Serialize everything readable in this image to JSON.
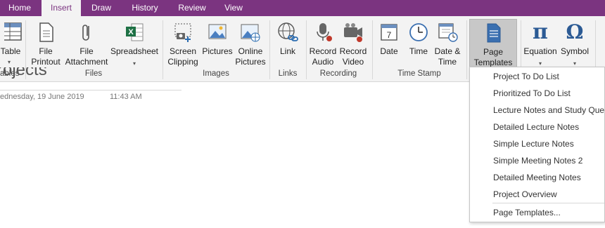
{
  "tabs": [
    "Home",
    "Insert",
    "Draw",
    "History",
    "Review",
    "View"
  ],
  "ribbon": {
    "table": {
      "label": "Table",
      "group": "ables"
    },
    "files": {
      "group": "Files",
      "printout": "File\nPrintout",
      "attachment": "File\nAttachment",
      "spreadsheet": "Spreadsheet"
    },
    "images": {
      "group": "Images",
      "screen_clipping": "Screen\nClipping",
      "pictures": "Pictures",
      "online_pictures": "Online\nPictures"
    },
    "links": {
      "group": "Links",
      "link": "Link"
    },
    "recording": {
      "group": "Recording",
      "audio": "Record\nAudio",
      "video": "Record\nVideo"
    },
    "timestamp": {
      "group": "Time Stamp",
      "date": "Date",
      "time": "Time",
      "date_time": "Date &\nTime",
      "calendar_day": "7"
    },
    "page_templates": "Page\nTemplates",
    "equation": "Equation",
    "symbol": "Symbol"
  },
  "page": {
    "title_fragment": "rojects",
    "date": "ednesday, 19 June 2019",
    "time": "11:43 AM"
  },
  "dropdown": {
    "items": [
      "Project To Do List",
      "Prioritized To Do List",
      "Lecture Notes and Study Ques",
      "Detailed Lecture Notes",
      "Simple Lecture Notes",
      "Simple Meeting Notes 2",
      "Detailed Meeting Notes",
      "Project Overview"
    ],
    "footer": "Page Templates..."
  },
  "colors": {
    "accent": "#7b3480",
    "ribbon_bg": "#f3f3f3",
    "excel_green": "#1e7145"
  }
}
